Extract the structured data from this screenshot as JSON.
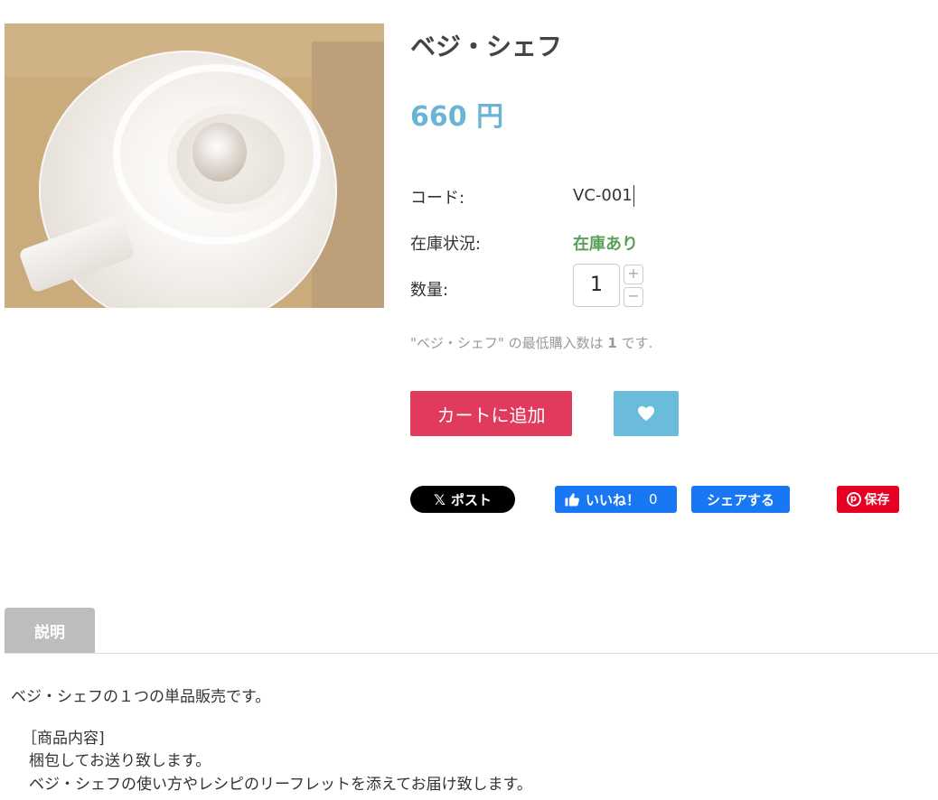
{
  "product": {
    "title": "ベジ・シェフ",
    "price": "660 円",
    "code_label": "コード:",
    "code_value": "VC-001",
    "stock_label": "在庫状況:",
    "stock_value": "在庫あり",
    "quantity_label": "数量:",
    "quantity_value": "1",
    "qty_plus": "+",
    "qty_minus": "−",
    "min_note_prefix": "\"ベジ・シェフ\" の最低購入数は",
    "min_note_count": "1",
    "min_note_suffix": "です."
  },
  "actions": {
    "add_to_cart": "カートに追加",
    "wishlist_icon": "heart-icon"
  },
  "social": {
    "x_post": "ポスト",
    "fb_like": "いいね！",
    "fb_like_count": "0",
    "fb_share": "シェアする",
    "pinterest_save": "保存"
  },
  "tabs": {
    "description": "説明"
  },
  "description": {
    "line1": "ベジ・シェフの１つの単品販売です。",
    "line2": "［商品内容]",
    "line3": "梱包してお送り致します。",
    "line4": "ベジ・シェフの使い方やレシピのリーフレットを添えてお届け致します。"
  },
  "colors": {
    "price": "#6ab5d4",
    "stock": "#5aa05a",
    "cart_button": "#e03a5c",
    "wish_button": "#6bbcdc",
    "facebook": "#1877f2",
    "pinterest": "#e60023"
  }
}
